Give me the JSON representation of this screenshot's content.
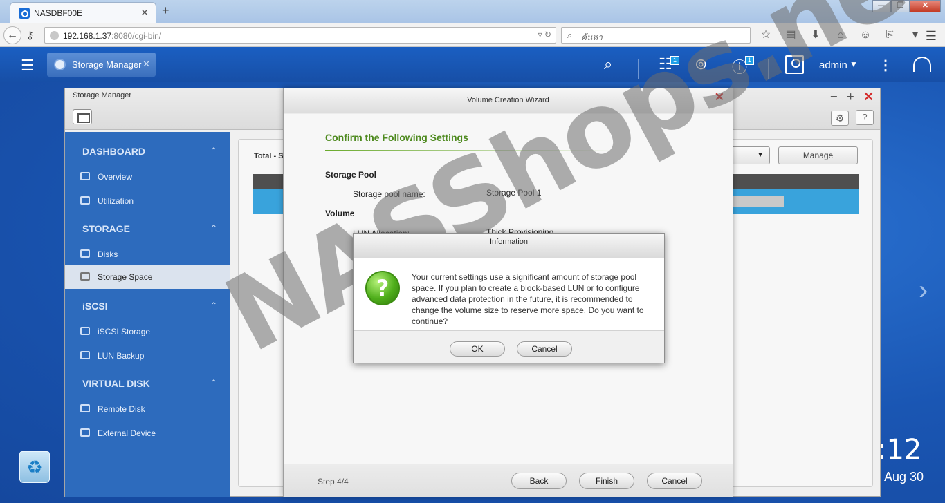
{
  "browser": {
    "tab_title": "NASDBF00E",
    "url_host": "192.168.1.37",
    "url_rest": ":8080/cgi-bin/",
    "search_placeholder": "ค้นหา",
    "window_controls": [
      "—",
      "❐",
      "✕"
    ]
  },
  "qts": {
    "app_chip_label": "Storage Manager",
    "notification_badges": [
      "1",
      "1"
    ],
    "user": "admin",
    "clock": ":12",
    "date": "Aug 30"
  },
  "storage_manager": {
    "title": "Storage Manager",
    "sidebar": {
      "sections": [
        {
          "title": "DASHBOARD",
          "items": [
            {
              "label": "Overview"
            },
            {
              "label": "Utilization"
            }
          ]
        },
        {
          "title": "STORAGE",
          "items": [
            {
              "label": "Disks"
            },
            {
              "label": "Storage Space",
              "active": true
            }
          ]
        },
        {
          "title": "iSCSI",
          "items": [
            {
              "label": "iSCSI Storage"
            },
            {
              "label": "LUN Backup"
            }
          ]
        },
        {
          "title": "VIRTUAL DISK",
          "items": [
            {
              "label": "Remote Disk"
            },
            {
              "label": "External Device"
            }
          ]
        }
      ]
    },
    "content": {
      "total_label": "Total - S",
      "manage_button": "Manage"
    }
  },
  "wizard": {
    "title": "Volume Creation Wizard",
    "heading": "Confirm the Following Settings",
    "section_storage_pool": "Storage Pool",
    "pool_name_label": "Storage pool name:",
    "pool_name_value": "Storage Pool 1",
    "section_volume": "Volume",
    "lun_allocation_label": "LUN Allocation:",
    "lun_allocation_value": "Thick Provisioning",
    "step": "Step 4/4",
    "buttons": {
      "back": "Back",
      "finish": "Finish",
      "cancel": "Cancel"
    }
  },
  "info_dialog": {
    "title": "Information",
    "message": "Your current settings use a significant amount of storage pool space. If you plan to create a block-based LUN or to configure advanced data protection in the future, it is recommended to change the volume size to reserve more space. Do you want to continue?",
    "ok": "OK",
    "cancel": "Cancel"
  },
  "watermark": "NASShops.net"
}
